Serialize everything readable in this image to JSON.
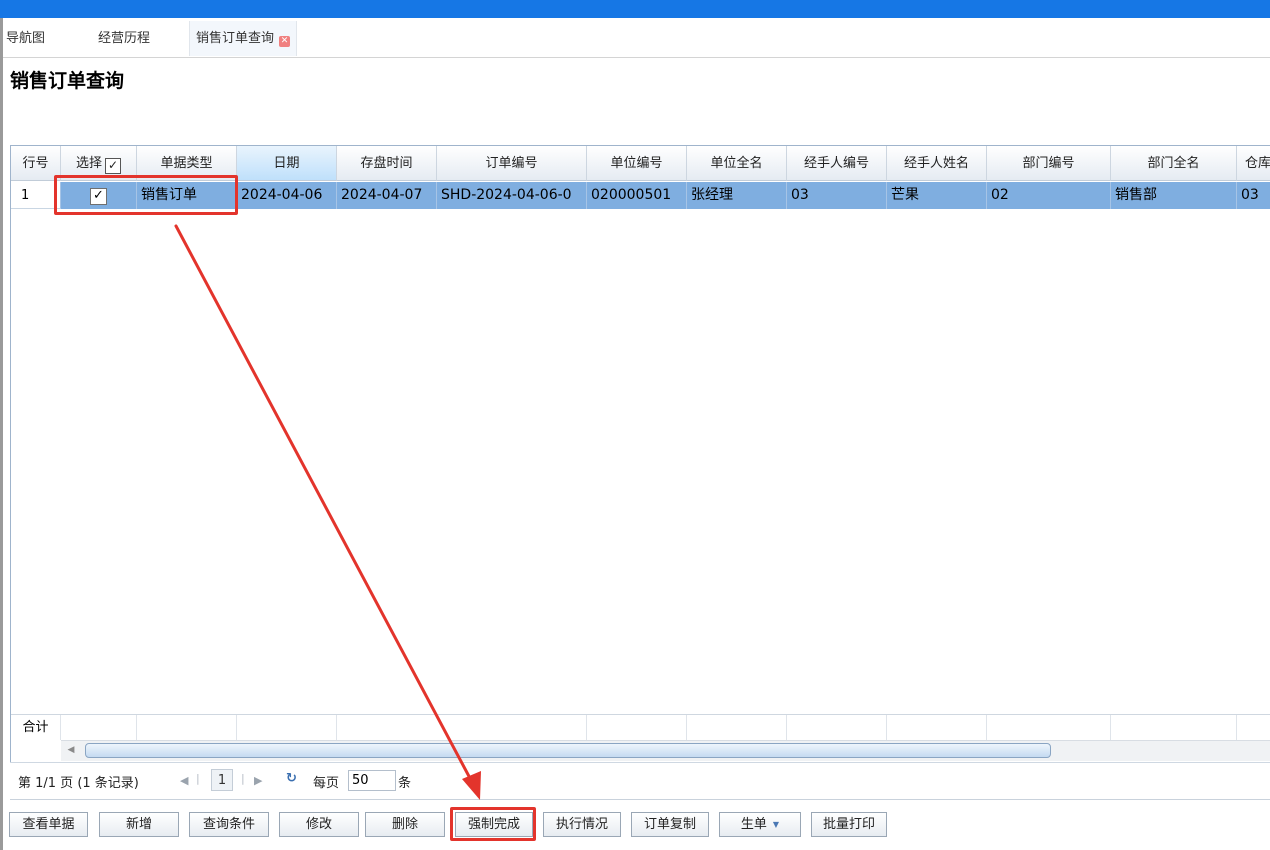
{
  "tabs": [
    {
      "label": "导航图",
      "active": false
    },
    {
      "label": "经营历程",
      "active": false
    },
    {
      "label": "销售订单查询",
      "active": true
    }
  ],
  "page": {
    "title": "销售订单查询"
  },
  "grid": {
    "headers": [
      "行号",
      "选择",
      "单据类型",
      "日期",
      "存盘时间",
      "订单编号",
      "单位编号",
      "单位全名",
      "经手人编号",
      "经手人姓名",
      "部门编号",
      "部门全名",
      "仓库"
    ],
    "select_all_checked": true,
    "rows": [
      {
        "row_no": "1",
        "selected": true,
        "cells": [
          "销售订单",
          "2024-04-06",
          "2024-04-07",
          "SHD-2024-04-06-0",
          "020000501",
          "张经理",
          "03",
          "芒果",
          "02",
          "销售部",
          "03"
        ]
      }
    ],
    "summary_label": "合计"
  },
  "pager": {
    "page_info": "第 1/1 页 (1 条记录)",
    "current_page": "1",
    "per_page_label": "每页",
    "page_size": "50",
    "unit": "条"
  },
  "toolbar": {
    "buttons": [
      "查看单据",
      "新增",
      "查询条件",
      "修改",
      "删除",
      "强制完成",
      "执行情况",
      "订单复制",
      "生单",
      "批量打印"
    ]
  },
  "colors": {
    "accent": "#1677e5",
    "selected_row": "#7faee0",
    "highlight": "#e3342c"
  }
}
